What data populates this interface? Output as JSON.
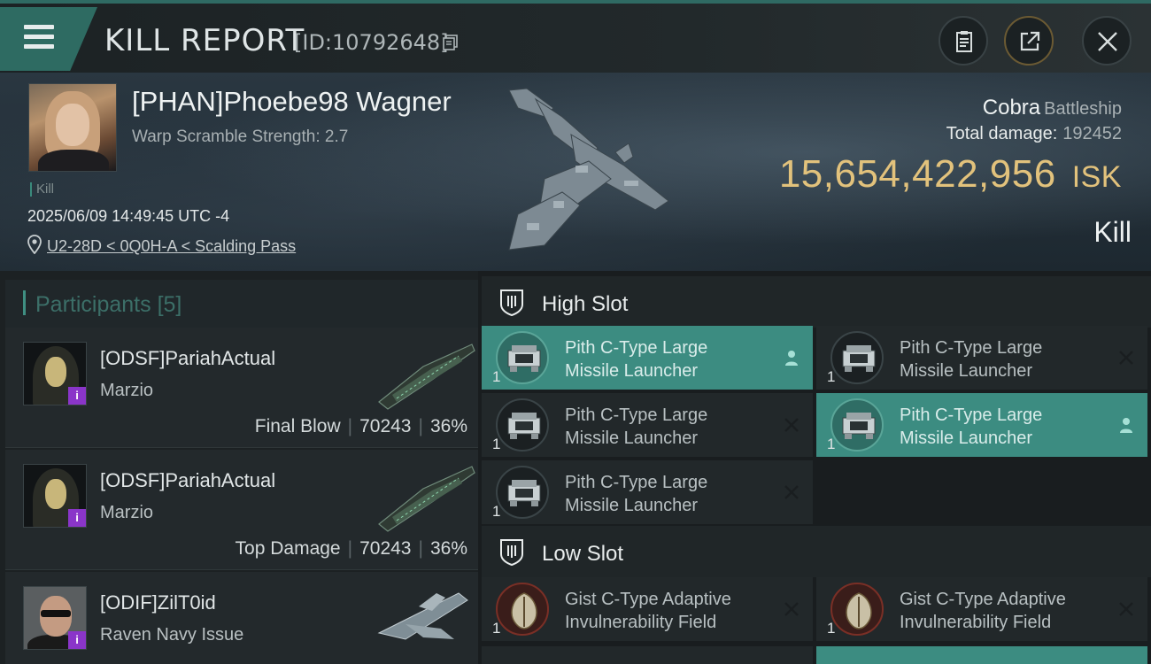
{
  "header": {
    "title": "KILL REPORT",
    "report_id": "[ID:10792648]"
  },
  "victim": {
    "name": "[PHAN]Phoebe98 Wagner",
    "warp_scramble": "Warp Scramble Strength: 2.7",
    "tag": "Kill",
    "datetime": "2025/06/09 14:49:45 UTC -4",
    "location": "U2-28D < 0Q0H-A < Scalding Pass",
    "ship": "Cobra",
    "ship_class": "Battleship",
    "total_damage_label": "Total damage:",
    "total_damage": "192452",
    "isk_value": "15,654,422,956",
    "isk_unit": "ISK",
    "result": "Kill"
  },
  "participants": {
    "title": "Participants",
    "count": "[5]",
    "rows": [
      {
        "name": "[ODSF]PariahActual",
        "ship": "Marzio",
        "label": "Final Blow",
        "damage": "70243",
        "percent": "36%"
      },
      {
        "name": "[ODSF]PariahActual",
        "ship": "Marzio",
        "label": "Top Damage",
        "damage": "70243",
        "percent": "36%"
      },
      {
        "name": "[ODIF]ZilT0id",
        "ship": "Raven Navy Issue"
      }
    ]
  },
  "fitting": {
    "high_slot_label": "High Slot",
    "low_slot_label": "Low Slot",
    "high": [
      {
        "line1": "Pith C-Type Large",
        "line2": "Missile Launcher",
        "qty": "1",
        "state": "fitted"
      },
      {
        "line1": "Pith C-Type Large",
        "line2": "Missile Launcher",
        "qty": "1",
        "state": "destroyed"
      },
      {
        "line1": "Pith C-Type Large",
        "line2": "Missile Launcher",
        "qty": "1",
        "state": "destroyed"
      },
      {
        "line1": "Pith C-Type Large",
        "line2": "Missile Launcher",
        "qty": "1",
        "state": "fitted"
      },
      {
        "line1": "Pith C-Type Large",
        "line2": "Missile Launcher",
        "qty": "1",
        "state": "destroyed"
      }
    ],
    "low": [
      {
        "line1": "Gist C-Type Adaptive",
        "line2": "Invulnerability Field",
        "qty": "1",
        "state": "destroyed"
      },
      {
        "line1": "Gist C-Type Adaptive",
        "line2": "Invulnerability Field",
        "qty": "1",
        "state": "destroyed"
      }
    ]
  },
  "icons": {
    "menu": "hamburger-icon",
    "copy": "copy-icon",
    "clipboard": "clipboard-icon",
    "share": "share-icon",
    "close": "close-icon",
    "location": "location-pin-icon",
    "slot": "shield-slot-icon",
    "fitted": "person-icon",
    "destroyed": "cross-icon"
  },
  "colors": {
    "accent": "#3c8c81",
    "isk": "#e2c27c",
    "corp_badge": "#8a35c9"
  }
}
